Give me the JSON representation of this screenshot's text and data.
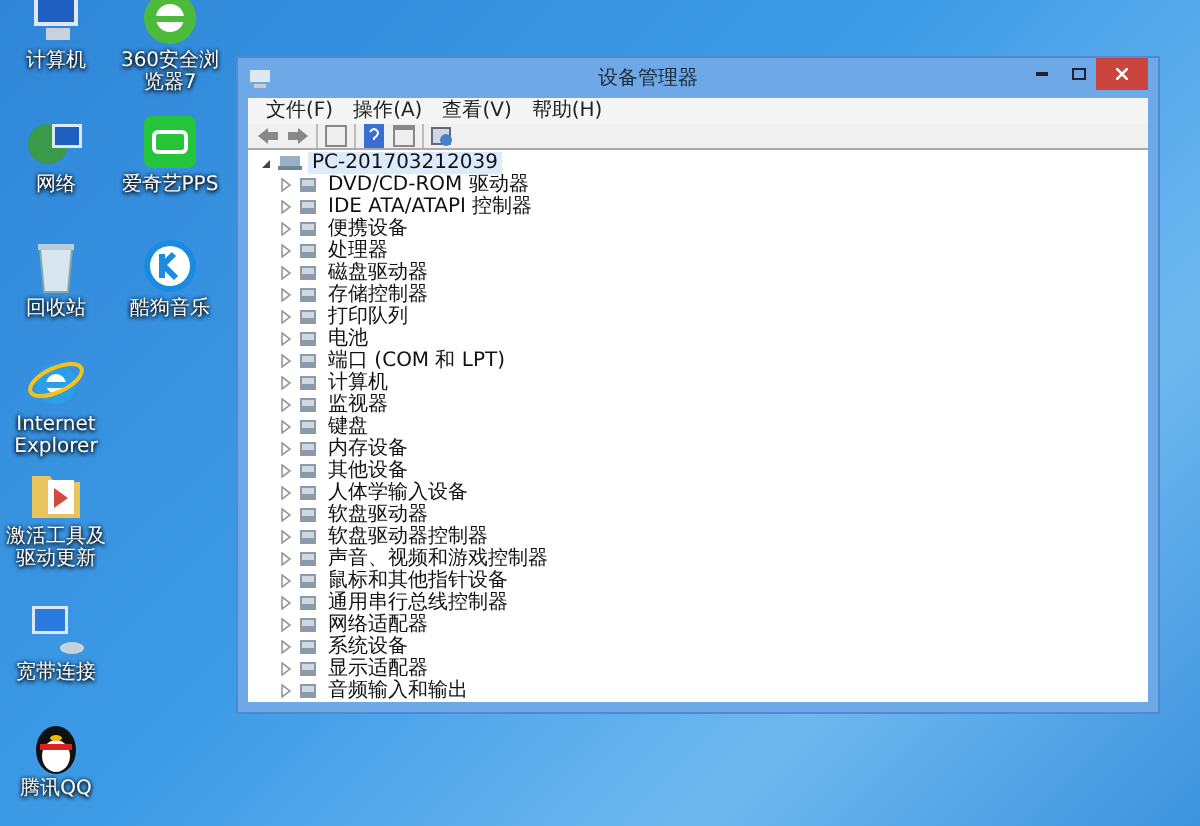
{
  "desktop_icons": [
    {
      "kind": "computer",
      "label": "计算机"
    },
    {
      "kind": "browser",
      "label": "360安全浏览器7"
    },
    {
      "kind": "network",
      "label": "网络"
    },
    {
      "kind": "video",
      "label": "爱奇艺PPS"
    },
    {
      "kind": "recycle",
      "label": "回收站"
    },
    {
      "kind": "music",
      "label": "酷狗音乐"
    },
    {
      "kind": "ie",
      "label": "Internet Explorer"
    },
    {
      "kind": "folder",
      "label": "激活工具及驱动更新"
    },
    {
      "kind": "broadband",
      "label": "宽带连接"
    },
    {
      "kind": "penguin",
      "label": "腾讯QQ"
    }
  ],
  "window": {
    "title": "设备管理器",
    "menu": [
      "文件(F)",
      "操作(A)",
      "查看(V)",
      "帮助(H)"
    ],
    "tree": {
      "label": "PC-201703212039",
      "expanded": true,
      "selected": true,
      "children": [
        {
          "label": "DVD/CD-ROM 驱动器",
          "expanded": false,
          "selected": false
        },
        {
          "label": "IDE ATA/ATAPI 控制器",
          "expanded": false,
          "selected": false
        },
        {
          "label": "便携设备",
          "expanded": false,
          "selected": false
        },
        {
          "label": "处理器",
          "expanded": false,
          "selected": false
        },
        {
          "label": "磁盘驱动器",
          "expanded": false,
          "selected": false
        },
        {
          "label": "存储控制器",
          "expanded": false,
          "selected": false
        },
        {
          "label": "打印队列",
          "expanded": false,
          "selected": false
        },
        {
          "label": "电池",
          "expanded": false,
          "selected": false
        },
        {
          "label": "端口 (COM 和 LPT)",
          "expanded": false,
          "selected": false
        },
        {
          "label": "计算机",
          "expanded": false,
          "selected": false
        },
        {
          "label": "监视器",
          "expanded": false,
          "selected": false
        },
        {
          "label": "键盘",
          "expanded": false,
          "selected": false
        },
        {
          "label": "内存设备",
          "expanded": false,
          "selected": false
        },
        {
          "label": "其他设备",
          "expanded": false,
          "selected": false
        },
        {
          "label": "人体学输入设备",
          "expanded": false,
          "selected": false
        },
        {
          "label": "软盘驱动器",
          "expanded": false,
          "selected": false
        },
        {
          "label": "软盘驱动器控制器",
          "expanded": false,
          "selected": false
        },
        {
          "label": "声音、视频和游戏控制器",
          "expanded": false,
          "selected": false
        },
        {
          "label": "鼠标和其他指针设备",
          "expanded": false,
          "selected": false
        },
        {
          "label": "通用串行总线控制器",
          "expanded": false,
          "selected": false
        },
        {
          "label": "网络适配器",
          "expanded": false,
          "selected": false
        },
        {
          "label": "系统设备",
          "expanded": false,
          "selected": false
        },
        {
          "label": "显示适配器",
          "expanded": false,
          "selected": false
        },
        {
          "label": "音频输入和输出",
          "expanded": false,
          "selected": false
        }
      ]
    }
  }
}
